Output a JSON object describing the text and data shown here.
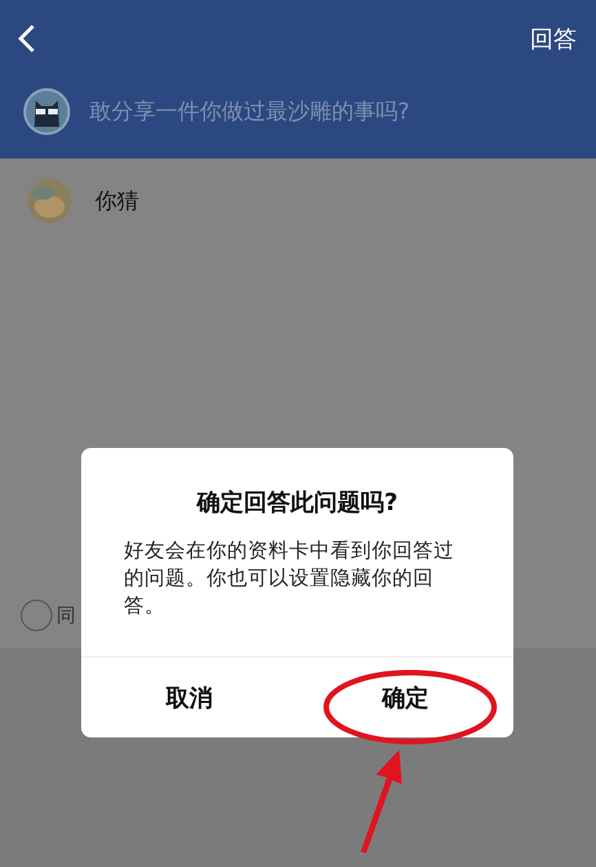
{
  "header": {
    "action": "回答"
  },
  "question": {
    "text": "敢分享一件你做过最沙雕的事吗?"
  },
  "answer": {
    "text": "你猜"
  },
  "option": {
    "label": "同",
    "checked": false
  },
  "dialog": {
    "title": "确定回答此问题吗?",
    "message": "好友会在你的资料卡中看到你回答过的问题。你也可以设置隐藏你的回答。",
    "buttons": [
      {
        "label": "取消",
        "circled": false
      },
      {
        "label": "确定",
        "circled": true
      }
    ]
  }
}
